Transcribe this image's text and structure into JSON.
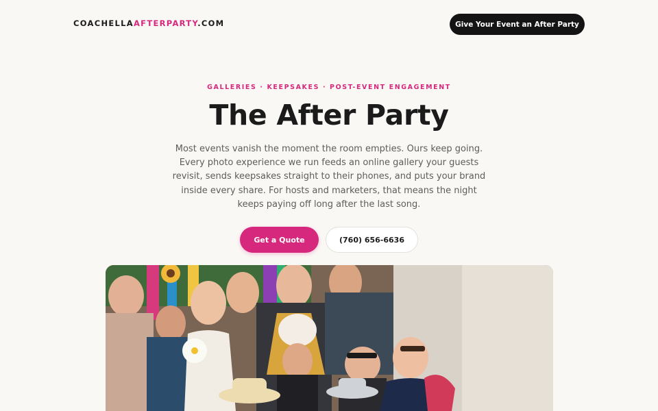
{
  "header": {
    "logo_main": "COACHELLA",
    "logo_accent": "AFTERPARTY",
    "logo_tld": ".COM",
    "cta_label": "Give Your Event an After Party"
  },
  "hero": {
    "eyebrow": "GALLERIES · KEEPSAKES · POST-EVENT ENGAGEMENT",
    "title": "The After Party",
    "body": "Most events vanish the moment the room empties. Ours keep going. Every photo experience we run feeds an online gallery your guests revisit, sends keepsakes straight to their phones, and puts your brand inside every share. For hosts and marketers, that means the night keeps paying off long after the last song.",
    "primary_button": "Get a Quote",
    "secondary_button": "(760) 656-6636"
  },
  "colors": {
    "accent": "#d6287d",
    "background": "#faf8f5",
    "dark": "#141414"
  }
}
